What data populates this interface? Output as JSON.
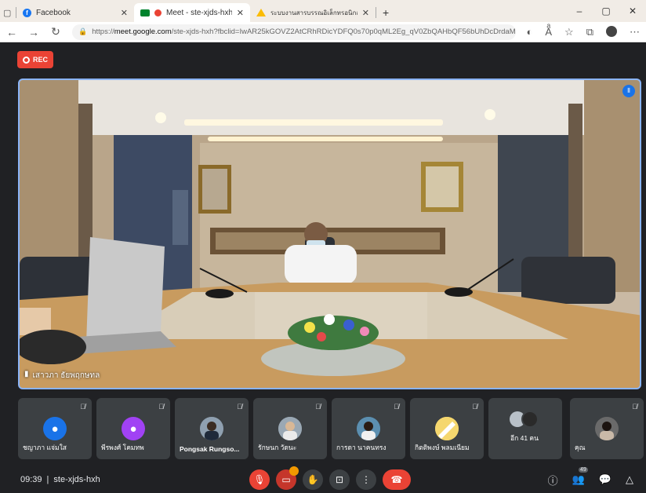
{
  "browser": {
    "tabs": [
      {
        "title": "Facebook",
        "icon": "facebook-icon"
      },
      {
        "title": "Meet - ste-xjds-hxh",
        "icon": "meet-icon"
      },
      {
        "title": "ระบบงานสารบรรณอิเล็กทรอนิกส์ที่ระ...",
        "icon": "drive-icon"
      }
    ],
    "url_prefix": "https://",
    "url_domain": "meet.google.com",
    "url_path": "/ste-xjds-hxh?fbclid=IwAR25kGOVZ2AtCRhRDicYDFQ0s70p0qML2Eg_qV0ZbQAHbQF56bUhDcDrdaM8pl...",
    "window_controls": [
      "–",
      "▢",
      "✕"
    ]
  },
  "recording": {
    "label": "REC",
    "color": "#ea4335"
  },
  "main_video": {
    "speaker_name": "เสาวภา ธัยพฤกษทล",
    "accent": "#8ab4f8"
  },
  "participants": [
    {
      "name": "ชญาภา แจ่มใส",
      "avatar_color": "#1a73e8",
      "avatar": "person"
    },
    {
      "name": "พีรพงศ์ โคมทพ",
      "avatar_color": "#a142f4",
      "avatar": "person"
    },
    {
      "name": "Pongsak Rungso...",
      "avatar_color": "#5f6368",
      "avatar": "photo"
    },
    {
      "name": "รักษนก วัดนะ",
      "avatar_color": "#7a8b99",
      "avatar": "photo"
    },
    {
      "name": "การดา นาคนทรง",
      "avatar_color": "#2d6a8a",
      "avatar": "photo"
    },
    {
      "name": "กิตติพงษ์ พลมเนียม",
      "avatar_color": "#f5d76e",
      "avatar": "photo"
    },
    {
      "name": "อีก 41 คน",
      "avatar_color": "#5f6368",
      "avatar": "group"
    },
    {
      "name": "คุณ",
      "avatar_color": "#4a4a4a",
      "avatar": "photo"
    }
  ],
  "bottom": {
    "time": "09:39",
    "separator": "|",
    "meeting_code": "ste-xjds-hxh",
    "chat_badge": "",
    "people_count": "49"
  }
}
